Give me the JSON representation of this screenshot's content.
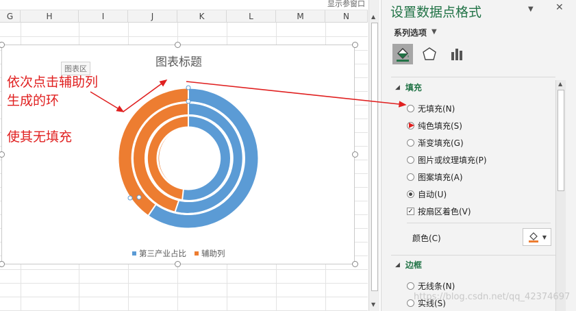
{
  "top_strip": {
    "label": "显示参窗口"
  },
  "sheet": {
    "columns": [
      "G",
      "H",
      "I",
      "J",
      "K",
      "L",
      "M",
      "N"
    ]
  },
  "chart": {
    "title": "图表标题",
    "area_tooltip": "图表区",
    "legend": [
      {
        "label": "第三产业占比",
        "color": "#5b9bd5"
      },
      {
        "label": "辅助列",
        "color": "#ed7d31"
      }
    ]
  },
  "annotations": {
    "line1": "依次点击辅助列",
    "line2": "生成的环",
    "line3": "使其无填充"
  },
  "pane": {
    "title": "设置数据点格式",
    "subtitle": "系列选项",
    "tabs": [
      "fill-line-icon",
      "pentagon-effects-icon",
      "bar-chart-series-icon"
    ],
    "fill_section": {
      "label": "填充",
      "options": [
        {
          "label": "无填充(N)",
          "selected": false
        },
        {
          "label": "纯色填充(S)",
          "selected": false
        },
        {
          "label": "渐变填充(G)",
          "selected": false
        },
        {
          "label": "图片或纹理填充(P)",
          "selected": false
        },
        {
          "label": "图案填充(A)",
          "selected": false
        },
        {
          "label": "自动(U)",
          "selected": true
        }
      ],
      "vary_colors": {
        "label": "按扇区着色(V)",
        "checked": true
      },
      "color_label": "颜色(C)"
    },
    "border_section": {
      "label": "边框",
      "options": [
        {
          "label": "无线条(N)",
          "selected": false
        },
        {
          "label": "实线(S)",
          "selected": false
        }
      ]
    }
  },
  "colors": {
    "accent_green": "#217346",
    "series_blue": "#5b9bd5",
    "series_orange": "#ed7d31",
    "annotation_red": "#e02020"
  },
  "watermark": "https://blog.csdn.net/qq_42374697"
}
